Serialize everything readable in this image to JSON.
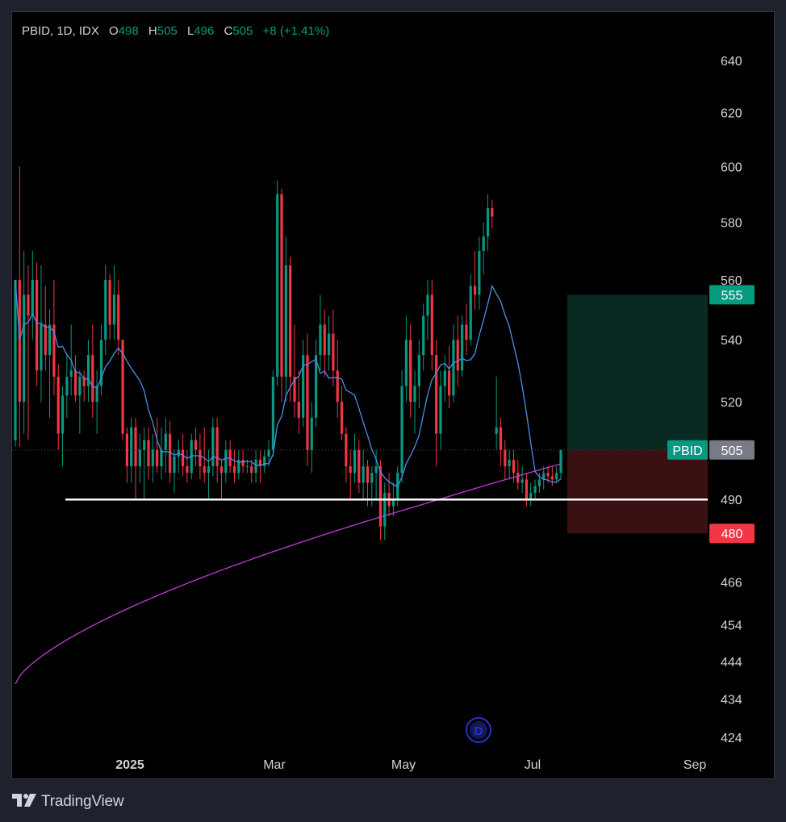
{
  "legend": {
    "symbol": "PBID, 1D, IDX",
    "o_label": "O",
    "o_value": "498",
    "h_label": "H",
    "h_value": "505",
    "l_label": "L",
    "l_value": "496",
    "c_label": "C",
    "c_value": "505",
    "change": "+8 (+1.41%)"
  },
  "footer": {
    "brand": "TradingView"
  },
  "colors": {
    "up": "#089981",
    "down": "#f23645",
    "ma_fast": "#4c8ee8",
    "ma_slow": "#c13cd6",
    "target_zone": "#082a22",
    "stop_zone": "#3a1013",
    "support": "#ffffff"
  },
  "chart_data": {
    "type": "candlestick",
    "symbol": "PBID",
    "interval": "1D",
    "exchange": "IDX",
    "y_ticks": [
      424,
      434,
      444,
      454,
      466,
      490,
      520,
      540,
      560,
      580,
      600,
      620,
      640
    ],
    "y_scale": "log",
    "x_labels": [
      "2025",
      "Mar",
      "May",
      "Jul",
      "Sep"
    ],
    "last_price": 505,
    "last_price_label": "PBID",
    "target_price": 555,
    "stop_price": 480,
    "support_level": 490,
    "ohlc": [
      [
        508,
        560,
        506,
        560
      ],
      [
        560,
        600,
        506,
        520
      ],
      [
        520,
        570,
        510,
        555
      ],
      [
        555,
        565,
        508,
        548
      ],
      [
        548,
        570,
        540,
        560
      ],
      [
        560,
        566,
        525,
        530
      ],
      [
        530,
        565,
        520,
        545
      ],
      [
        545,
        558,
        530,
        535
      ],
      [
        535,
        550,
        515,
        545
      ],
      [
        545,
        560,
        522,
        528
      ],
      [
        528,
        532,
        505,
        510
      ],
      [
        510,
        525,
        500,
        522
      ],
      [
        522,
        535,
        515,
        528
      ],
      [
        528,
        545,
        522,
        530
      ],
      [
        530,
        535,
        520,
        522
      ],
      [
        522,
        530,
        510,
        528
      ],
      [
        528,
        530,
        520,
        525
      ],
      [
        525,
        540,
        520,
        535
      ],
      [
        535,
        545,
        515,
        520
      ],
      [
        520,
        530,
        510,
        525
      ],
      [
        525,
        545,
        522,
        540
      ],
      [
        540,
        565,
        535,
        560
      ],
      [
        560,
        562,
        540,
        545
      ],
      [
        545,
        565,
        540,
        555
      ],
      [
        555,
        560,
        535,
        540
      ],
      [
        540,
        540,
        508,
        510
      ],
      [
        510,
        512,
        495,
        500
      ],
      [
        500,
        515,
        495,
        512
      ],
      [
        512,
        515,
        490,
        500
      ],
      [
        500,
        510,
        495,
        505
      ],
      [
        505,
        512,
        490,
        508
      ],
      [
        508,
        512,
        496,
        500
      ],
      [
        500,
        510,
        495,
        505
      ],
      [
        505,
        515,
        498,
        500
      ],
      [
        500,
        512,
        496,
        505
      ],
      [
        505,
        515,
        498,
        510
      ],
      [
        510,
        514,
        495,
        498
      ],
      [
        498,
        505,
        492,
        503
      ],
      [
        503,
        508,
        498,
        505
      ],
      [
        505,
        510,
        497,
        500
      ],
      [
        500,
        505,
        495,
        498
      ],
      [
        498,
        510,
        496,
        508
      ],
      [
        508,
        512,
        500,
        505
      ],
      [
        505,
        510,
        496,
        500
      ],
      [
        500,
        512,
        495,
        498
      ],
      [
        498,
        505,
        490,
        500
      ],
      [
        500,
        515,
        497,
        512
      ],
      [
        512,
        515,
        495,
        500
      ],
      [
        500,
        502,
        490,
        498
      ],
      [
        498,
        508,
        495,
        505
      ],
      [
        505,
        508,
        498,
        500
      ],
      [
        500,
        505,
        495,
        498
      ],
      [
        498,
        505,
        496,
        502
      ],
      [
        502,
        505,
        498,
        500
      ],
      [
        500,
        502,
        498,
        500
      ],
      [
        500,
        502,
        495,
        498
      ],
      [
        498,
        505,
        495,
        502
      ],
      [
        502,
        505,
        495,
        500
      ],
      [
        500,
        505,
        498,
        503
      ],
      [
        503,
        508,
        500,
        505
      ],
      [
        505,
        530,
        503,
        528
      ],
      [
        528,
        595,
        525,
        590
      ],
      [
        590,
        592,
        520,
        528
      ],
      [
        528,
        575,
        520,
        565
      ],
      [
        565,
        568,
        520,
        528
      ],
      [
        528,
        545,
        515,
        520
      ],
      [
        520,
        530,
        510,
        515
      ],
      [
        515,
        540,
        512,
        535
      ],
      [
        535,
        542,
        500,
        505
      ],
      [
        505,
        520,
        498,
        515
      ],
      [
        515,
        540,
        512,
        535
      ],
      [
        535,
        555,
        530,
        545
      ],
      [
        545,
        550,
        528,
        535
      ],
      [
        535,
        548,
        530,
        542
      ],
      [
        542,
        550,
        525,
        530
      ],
      [
        530,
        540,
        515,
        520
      ],
      [
        520,
        525,
        508,
        510
      ],
      [
        510,
        512,
        495,
        500
      ],
      [
        500,
        505,
        490,
        498
      ],
      [
        498,
        510,
        495,
        505
      ],
      [
        505,
        508,
        492,
        495
      ],
      [
        495,
        505,
        490,
        500
      ],
      [
        500,
        502,
        488,
        495
      ],
      [
        495,
        500,
        488,
        498
      ],
      [
        498,
        505,
        490,
        500
      ],
      [
        500,
        502,
        478,
        482
      ],
      [
        482,
        495,
        478,
        492
      ],
      [
        492,
        498,
        485,
        488
      ],
      [
        488,
        495,
        485,
        490
      ],
      [
        490,
        500,
        488,
        498
      ],
      [
        498,
        530,
        495,
        525
      ],
      [
        525,
        548,
        520,
        540
      ],
      [
        540,
        545,
        515,
        520
      ],
      [
        520,
        530,
        510,
        525
      ],
      [
        525,
        540,
        518,
        535
      ],
      [
        535,
        552,
        530,
        548
      ],
      [
        548,
        560,
        540,
        555
      ],
      [
        555,
        560,
        530,
        535
      ],
      [
        535,
        540,
        500,
        510
      ],
      [
        510,
        530,
        505,
        525
      ],
      [
        525,
        535,
        520,
        530
      ],
      [
        530,
        538,
        518,
        522
      ],
      [
        522,
        545,
        520,
        540
      ],
      [
        540,
        548,
        525,
        530
      ],
      [
        530,
        548,
        528,
        545
      ],
      [
        545,
        552,
        535,
        540
      ],
      [
        540,
        562,
        538,
        558
      ],
      [
        558,
        570,
        550,
        555
      ],
      [
        555,
        575,
        550,
        570
      ],
      [
        570,
        580,
        562,
        575
      ],
      [
        575,
        590,
        570,
        585
      ],
      [
        585,
        588,
        578,
        582
      ],
      [
        510,
        528,
        505,
        512
      ],
      [
        512,
        515,
        500,
        505
      ],
      [
        505,
        508,
        496,
        500
      ],
      [
        500,
        505,
        496,
        502
      ],
      [
        502,
        505,
        495,
        498
      ],
      [
        498,
        502,
        493,
        495
      ],
      [
        495,
        500,
        492,
        496
      ],
      [
        496,
        498,
        488,
        490
      ],
      [
        490,
        495,
        488,
        492
      ],
      [
        492,
        496,
        490,
        494
      ],
      [
        494,
        498,
        492,
        496
      ],
      [
        496,
        500,
        493,
        498
      ],
      [
        498,
        500,
        495,
        497
      ],
      [
        497,
        500,
        494,
        496
      ],
      [
        496,
        500,
        495,
        498
      ],
      [
        498,
        505,
        496,
        505
      ]
    ],
    "ma_fast_label": "",
    "ma_slow_label": ""
  }
}
